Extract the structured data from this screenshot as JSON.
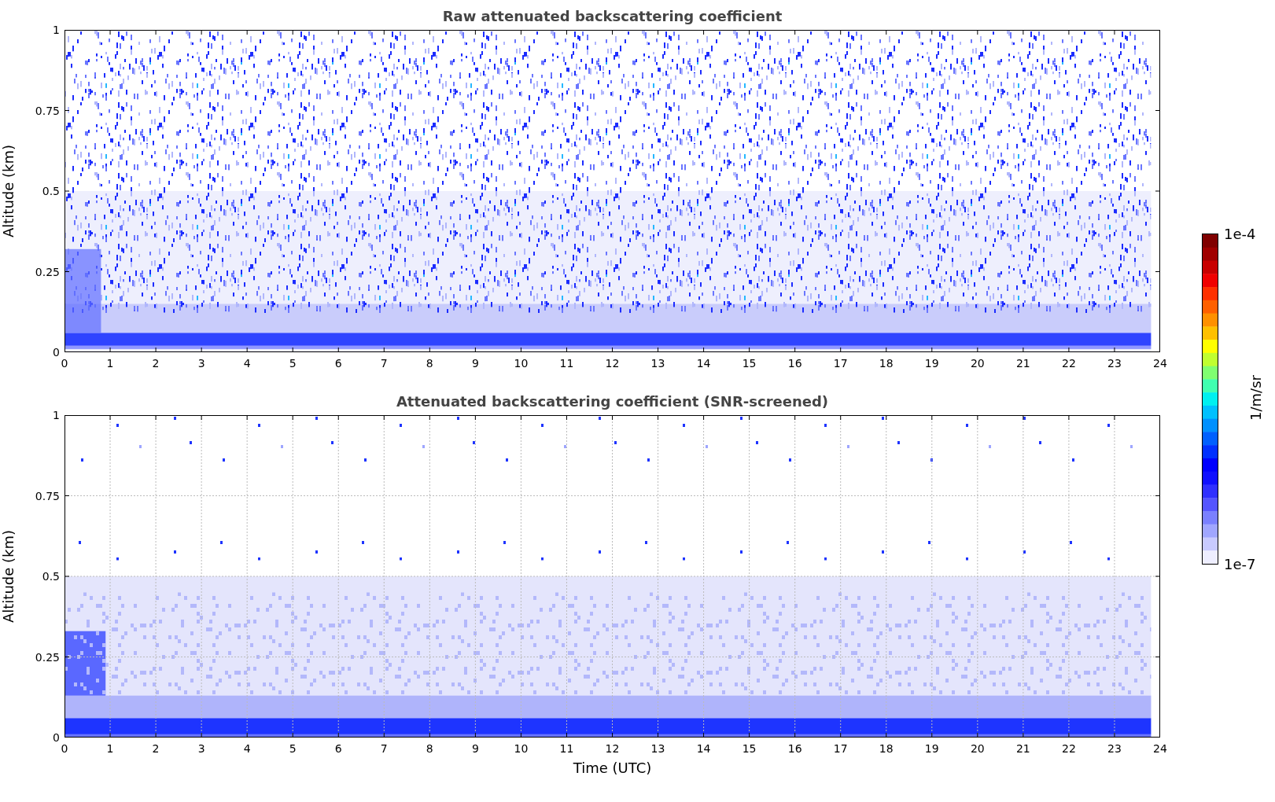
{
  "panels": [
    {
      "kind": "raw",
      "title": "Raw attenuated backscattering coefficient",
      "ylabel": "Altitude (km)",
      "grid": false,
      "yticks": [
        "1",
        "0.75",
        "0.5",
        "0.25",
        "0"
      ],
      "xticks": [
        "0",
        "1",
        "2",
        "3",
        "4",
        "5",
        "6",
        "7",
        "8",
        "9",
        "10",
        "11",
        "12",
        "13",
        "14",
        "15",
        "16",
        "17",
        "18",
        "19",
        "20",
        "21",
        "22",
        "23",
        "24"
      ]
    },
    {
      "kind": "screened",
      "title": "Attenuated backscattering coefficient (SNR-screened)",
      "ylabel": "Altitude (km)",
      "xlabel": "Time (UTC)",
      "grid": true,
      "yticks": [
        "1",
        "0.75",
        "0.5",
        "0.25",
        "0"
      ],
      "xticks": [
        "0",
        "1",
        "2",
        "3",
        "4",
        "5",
        "6",
        "7",
        "8",
        "9",
        "10",
        "11",
        "12",
        "13",
        "14",
        "15",
        "16",
        "17",
        "18",
        "19",
        "20",
        "21",
        "22",
        "23",
        "24"
      ]
    }
  ],
  "colorbar": {
    "max_label": "1e-4",
    "min_label": "1e-7",
    "label": "1/m/sr"
  }
}
